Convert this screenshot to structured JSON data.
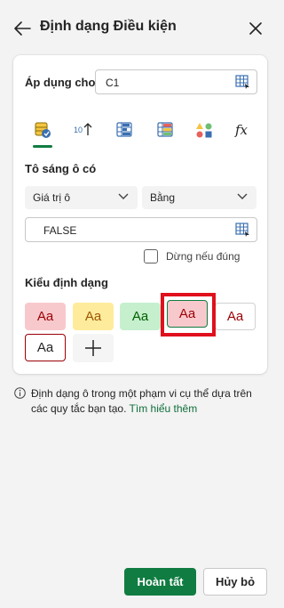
{
  "panel": {
    "title": "Định dạng Điều kiện",
    "back_icon": "arrow-left-icon",
    "close_icon": "close-icon"
  },
  "apply_to": {
    "label": "Áp dụng cho:",
    "value": "C1"
  },
  "rule_tabs": [
    {
      "name": "highlight-cells-icon",
      "active": true
    },
    {
      "name": "top-bottom-icon",
      "active": false
    },
    {
      "name": "data-bars-icon",
      "active": false
    },
    {
      "name": "color-scales-icon",
      "active": false
    },
    {
      "name": "icon-sets-icon",
      "active": false
    },
    {
      "name": "formula-icon",
      "active": false
    }
  ],
  "highlight": {
    "label": "Tô sáng ô có",
    "condition_type": "Giá trị ô",
    "operator": "Bằng",
    "value": "FALSE"
  },
  "stop_if_true": {
    "label": "Dừng nếu đúng",
    "checked": false
  },
  "format_style": {
    "label": "Kiểu định dạng",
    "swatch_text": "Aa",
    "swatches": [
      {
        "name": "light-red-fill",
        "bg": "#f8c9cc",
        "fg": "#9c0006",
        "border": "#f8c9cc"
      },
      {
        "name": "yellow-fill",
        "bg": "#ffeb9c",
        "fg": "#9c5700",
        "border": "#ffeb9c"
      },
      {
        "name": "green-fill",
        "bg": "#c6efce",
        "fg": "#006100",
        "border": "#c6efce"
      },
      {
        "name": "light-red-fill-selected",
        "bg": "#f8c9cc",
        "fg": "#9c0006",
        "border": "#107c41",
        "selected": true
      },
      {
        "name": "red-text",
        "bg": "#ffffff",
        "fg": "#9c0006",
        "border": "#d1d1d1"
      },
      {
        "name": "red-border",
        "bg": "#ffffff",
        "fg": "#242424",
        "border": "#9c0006"
      }
    ]
  },
  "info": {
    "text": "Định dạng ô trong một phạm vi cụ thể dựa trên các quy tắc bạn tạo.",
    "link": "Tìm hiểu thêm"
  },
  "buttons": {
    "done": "Hoàn tất",
    "cancel": "Hủy bỏ"
  },
  "colors": {
    "accent": "#107c41",
    "highlight_box": "#e0101c"
  }
}
